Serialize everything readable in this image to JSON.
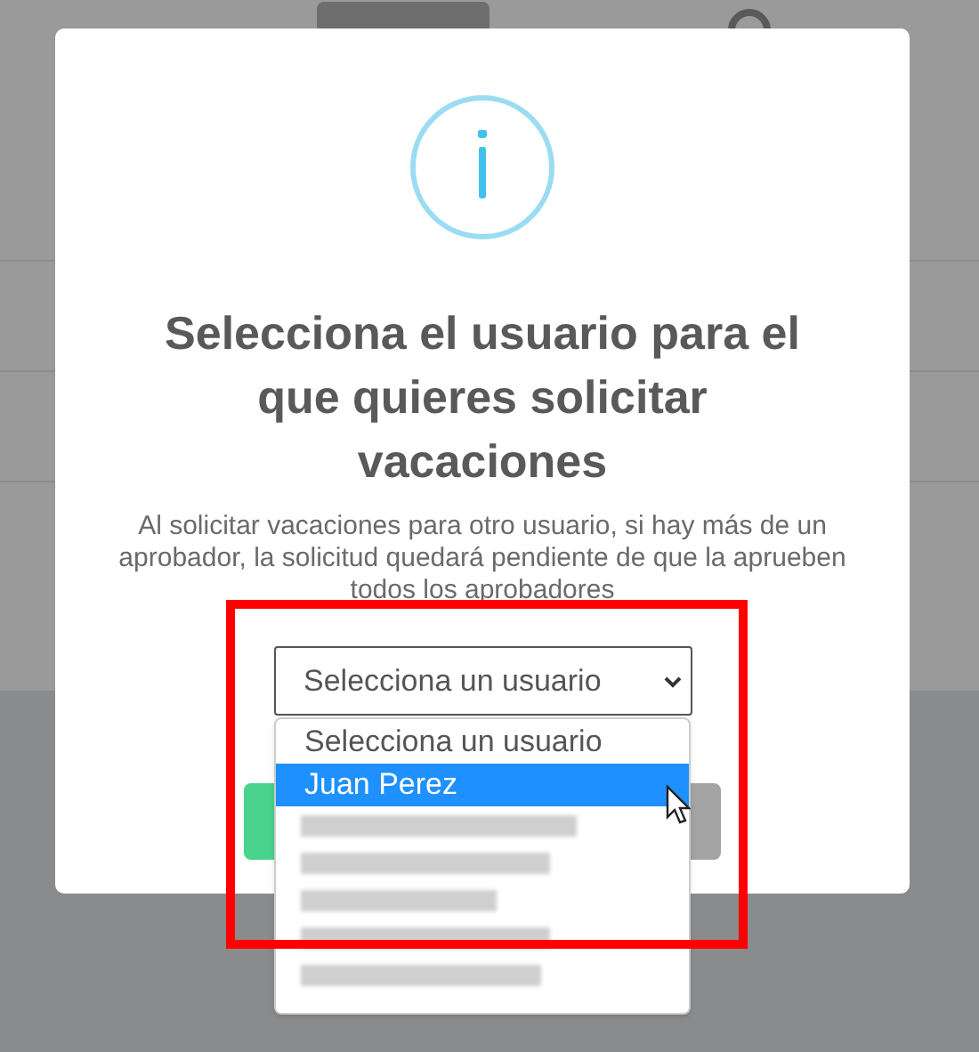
{
  "dialog": {
    "title": "Selecciona el usuario para el que quieres solicitar vacaciones",
    "message": "Al solicitar vacaciones para otro usuario, si hay más de un aprobador, la solicitud quedará pendiente de que la aprueben todos los aprobadores",
    "select": {
      "value": "Selecciona un usuario",
      "expanded": true,
      "options": [
        {
          "label": "Selecciona un usuario",
          "highlighted": false,
          "kind": "text"
        },
        {
          "label": "Juan Perez",
          "highlighted": true,
          "kind": "text"
        },
        {
          "kind": "redacted",
          "highlighted": false
        },
        {
          "kind": "redacted",
          "highlighted": false
        },
        {
          "kind": "redacted",
          "highlighted": false
        },
        {
          "kind": "redacted",
          "highlighted": false
        },
        {
          "kind": "redacted",
          "highlighted": false
        }
      ]
    }
  }
}
